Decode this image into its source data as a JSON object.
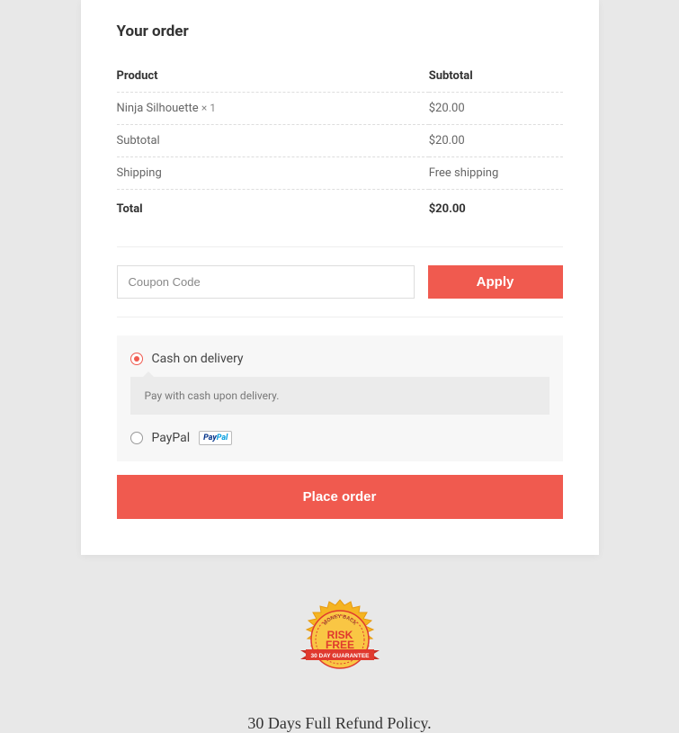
{
  "order": {
    "title": "Your order",
    "headers": {
      "product": "Product",
      "subtotal": "Subtotal"
    },
    "item": {
      "name": "Ninja Silhouette",
      "qty": "× 1",
      "price": "$20.00"
    },
    "subtotal": {
      "label": "Subtotal",
      "value": "$20.00"
    },
    "shipping": {
      "label": "Shipping",
      "value": "Free shipping"
    },
    "total": {
      "label": "Total",
      "value": "$20.00"
    }
  },
  "coupon": {
    "placeholder": "Coupon Code",
    "button": "Apply"
  },
  "payment": {
    "cod": {
      "label": "Cash on delivery",
      "description": "Pay with cash upon delivery."
    },
    "paypal": {
      "label": "PayPal"
    }
  },
  "place_order": "Place order",
  "badge": {
    "line1": "MONEY BACK",
    "line2": "RISK",
    "line3": "FREE",
    "line4": "30 DAY GUARANTEE"
  },
  "refund_policy": "30 Days Full Refund Policy."
}
